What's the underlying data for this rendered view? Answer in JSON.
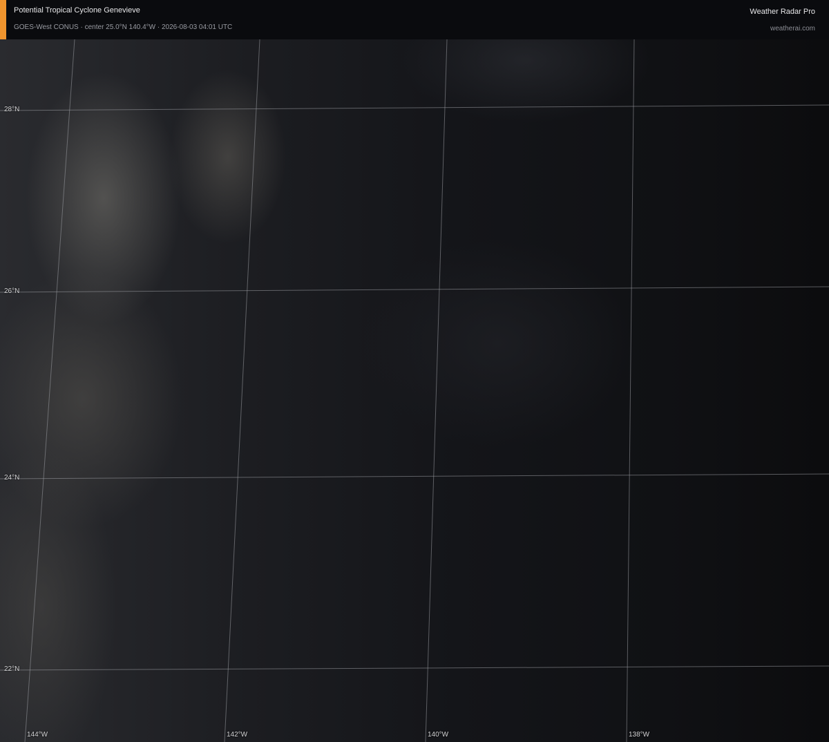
{
  "header": {
    "title": "Potential Tropical Cyclone Genevieve",
    "subtitle": "GOES-West CONUS · center 25.0°N 140.4°W · 2026-08-03 04:01 UTC",
    "brand": "Weather Radar Pro",
    "brand_url": "weatherai.com",
    "accent_color": "#f0952e"
  },
  "map": {
    "latitude_labels": [
      "28°N",
      "26°N",
      "24°N",
      "22°N"
    ],
    "longitude_labels": [
      "144°W",
      "142°W",
      "140°W",
      "138°W"
    ],
    "grid_color": "#9a9ca3"
  }
}
